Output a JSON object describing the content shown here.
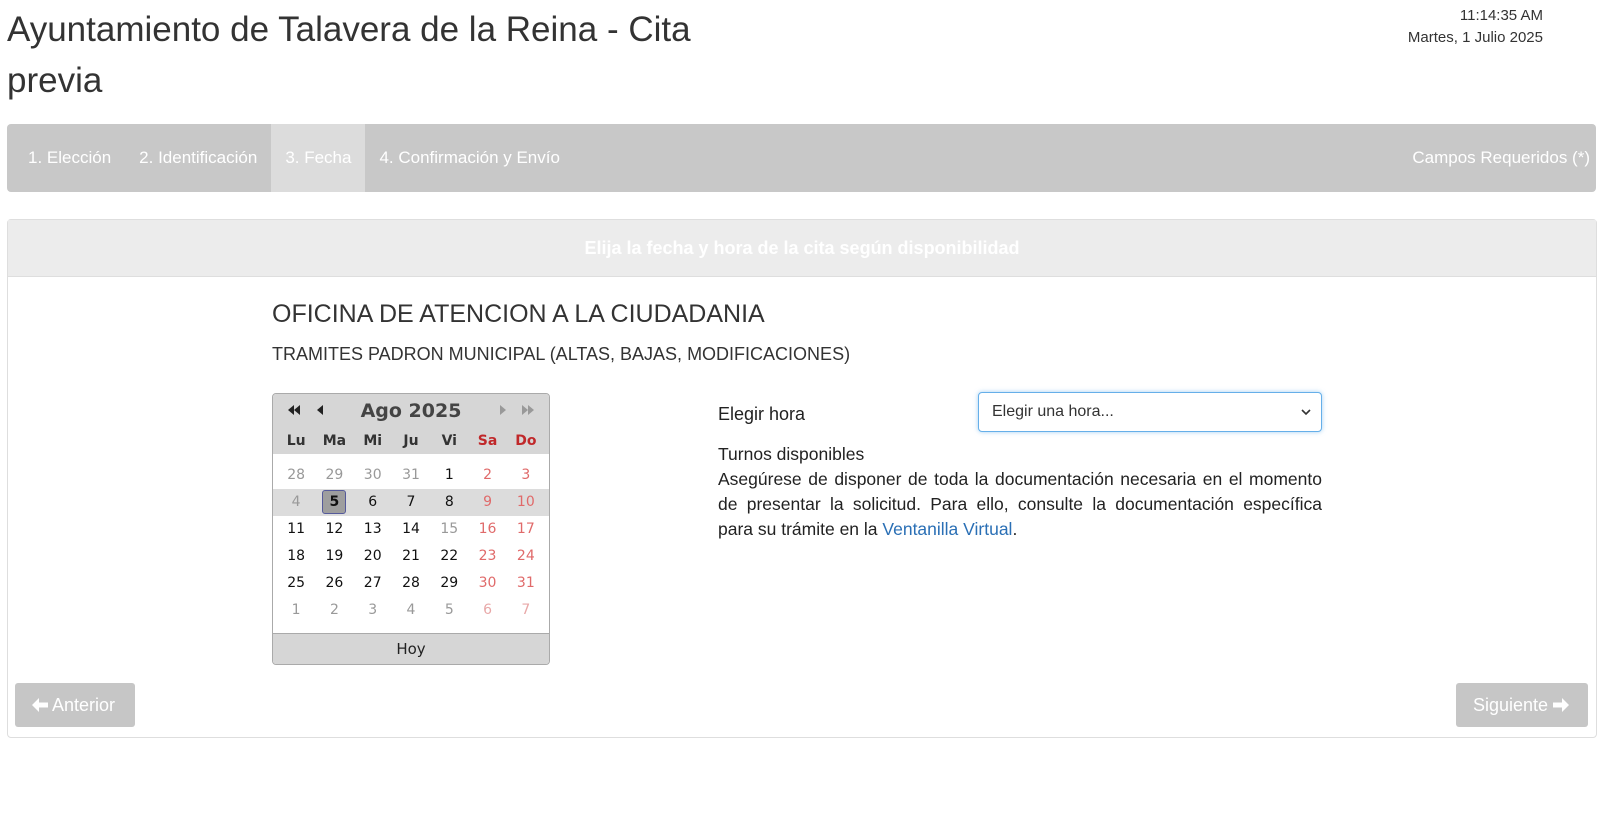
{
  "header": {
    "title": "Ayuntamiento de Talavera de la Reina - Cita previa",
    "time": "11:14:35 AM",
    "date": "Martes, 1 Julio 2025"
  },
  "steps": [
    {
      "label": "1. Elección",
      "active": false
    },
    {
      "label": "2. Identificación",
      "active": false
    },
    {
      "label": "3. Fecha",
      "active": true
    },
    {
      "label": "4. Confirmación y Envío",
      "active": false
    }
  ],
  "required_note": "Campos Requeridos (*)",
  "panel": {
    "heading": "Elija la fecha y hora de la cita según disponibilidad",
    "office": "OFICINA DE ATENCION A LA CIUDADANIA",
    "tramite": "TRAMITES PADRON MUNICIPAL (ALTAS, BAJAS, MODIFICACIONES)"
  },
  "calendar": {
    "title": "Ago 2025",
    "weekdays": [
      "Lu",
      "Ma",
      "Mi",
      "Ju",
      "Vi",
      "Sa",
      "Do"
    ],
    "weeks": [
      [
        {
          "d": "28",
          "o": true
        },
        {
          "d": "29",
          "o": true
        },
        {
          "d": "30",
          "o": true
        },
        {
          "d": "31",
          "o": true
        },
        {
          "d": "1"
        },
        {
          "d": "2"
        },
        {
          "d": "3"
        }
      ],
      [
        {
          "d": "4",
          "o": true
        },
        {
          "d": "5",
          "sel": true
        },
        {
          "d": "6"
        },
        {
          "d": "7"
        },
        {
          "d": "8"
        },
        {
          "d": "9"
        },
        {
          "d": "10"
        }
      ],
      [
        {
          "d": "11"
        },
        {
          "d": "12"
        },
        {
          "d": "13"
        },
        {
          "d": "14"
        },
        {
          "d": "15",
          "o": true
        },
        {
          "d": "16"
        },
        {
          "d": "17"
        }
      ],
      [
        {
          "d": "18"
        },
        {
          "d": "19"
        },
        {
          "d": "20"
        },
        {
          "d": "21"
        },
        {
          "d": "22"
        },
        {
          "d": "23"
        },
        {
          "d": "24"
        }
      ],
      [
        {
          "d": "25"
        },
        {
          "d": "26"
        },
        {
          "d": "27"
        },
        {
          "d": "28"
        },
        {
          "d": "29"
        },
        {
          "d": "30"
        },
        {
          "d": "31"
        }
      ],
      [
        {
          "d": "1",
          "o": true
        },
        {
          "d": "2",
          "o": true
        },
        {
          "d": "3",
          "o": true
        },
        {
          "d": "4",
          "o": true
        },
        {
          "d": "5",
          "o": true
        },
        {
          "d": "6",
          "o": true
        },
        {
          "d": "7",
          "o": true
        }
      ]
    ],
    "current_week_index": 1,
    "today_label": "Hoy"
  },
  "hora": {
    "label": "Elegir hora",
    "select_value": "Elegir una hora..."
  },
  "info": {
    "turnos": "Turnos disponibles",
    "text_before": "Asegúrese de disponer de toda la documentación necesaria en el momento de presentar la solicitud. Para ello, consulte la documentación específica para su trámite en la ",
    "link": "Ventanilla Virtual",
    "text_after": "."
  },
  "buttons": {
    "prev": "Anterior",
    "next": "Siguiente"
  },
  "icons": {
    "first": "double-left-icon",
    "prev": "left-icon",
    "next": "right-icon",
    "last": "double-right-icon",
    "back_arrow": "arrow-left-icon",
    "next_arrow": "arrow-right-icon",
    "select_chevron": "chevron-down-icon"
  },
  "colors": {
    "step_bar": "#c8c8c8",
    "active_step": "#dcdcdc",
    "link": "#2a6fb5",
    "weekend": "#c0282a",
    "button": "#c6c6c6"
  }
}
